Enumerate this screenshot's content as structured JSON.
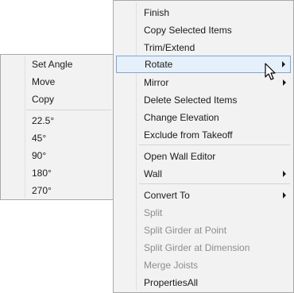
{
  "main_menu": {
    "items": [
      {
        "label": "Finish"
      },
      {
        "label": "Copy Selected Items"
      },
      {
        "label": "Trim/Extend"
      },
      {
        "label": "Rotate"
      },
      {
        "label": "Mirror"
      },
      {
        "label": "Delete Selected Items"
      },
      {
        "label": "Change Elevation"
      },
      {
        "label": "Exclude from Takeoff"
      },
      {
        "label": "Open Wall Editor"
      },
      {
        "label": "Wall"
      },
      {
        "label": "Convert To"
      },
      {
        "label": "Split"
      },
      {
        "label": "Split Girder at Point"
      },
      {
        "label": "Split Girder at Dimension"
      },
      {
        "label": "Merge Joists"
      },
      {
        "label": "PropertiesAll"
      }
    ]
  },
  "sub_menu": {
    "items": [
      {
        "label": "Set Angle"
      },
      {
        "label": "Move"
      },
      {
        "label": "Copy"
      },
      {
        "label": "22.5°"
      },
      {
        "label": "45°"
      },
      {
        "label": "90°"
      },
      {
        "label": "180°"
      },
      {
        "label": "270°"
      }
    ]
  },
  "icons": {
    "submenu_arrow": "chevron-right-icon",
    "cursor": "mouse-pointer-icon"
  },
  "colors": {
    "menu_bg": "#f2f2f2",
    "hover_bg": "#e6f0fb",
    "hover_border": "#7ba7d8",
    "disabled_text": "#8d8d8d"
  }
}
